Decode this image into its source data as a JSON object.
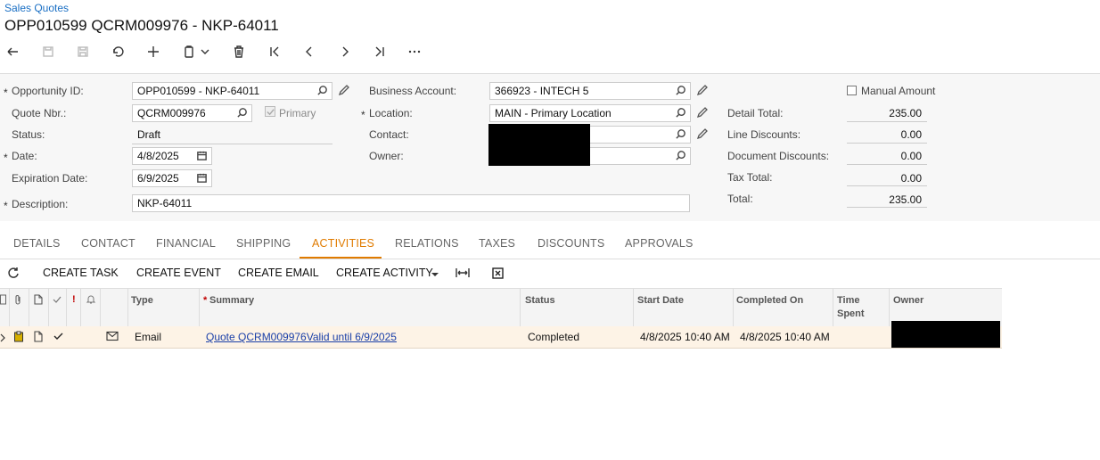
{
  "breadcrumb": "Sales Quotes",
  "title": "OPP010599 QCRM009976 - NKP-64011",
  "form": {
    "opportunity_id": {
      "label": "Opportunity ID:",
      "value": "OPP010599 - NKP-64011"
    },
    "quote_nbr": {
      "label": "Quote Nbr.:",
      "value": "QCRM009976"
    },
    "primary_label": "Primary",
    "status": {
      "label": "Status:",
      "value": "Draft"
    },
    "date": {
      "label": "Date:",
      "value": "4/8/2025"
    },
    "expiration_date": {
      "label": "Expiration Date:",
      "value": "6/9/2025"
    },
    "description": {
      "label": "Description:",
      "value": "NKP-64011"
    },
    "business_account": {
      "label": "Business Account:",
      "value": "366923 - INTECH 5"
    },
    "location": {
      "label": "Location:",
      "value": "MAIN - Primary Location"
    },
    "contact": {
      "label": "Contact:",
      "value": ""
    },
    "owner": {
      "label": "Owner:",
      "value": ""
    },
    "manual_amount_label": "Manual Amount",
    "detail_total": {
      "label": "Detail Total:",
      "value": "235.00"
    },
    "line_discounts": {
      "label": "Line Discounts:",
      "value": "0.00"
    },
    "document_discounts": {
      "label": "Document Discounts:",
      "value": "0.00"
    },
    "tax_total": {
      "label": "Tax Total:",
      "value": "0.00"
    },
    "total": {
      "label": "Total:",
      "value": "235.00"
    },
    "required_mark": "*"
  },
  "tabs": [
    "DETAILS",
    "CONTACT",
    "FINANCIAL",
    "SHIPPING",
    "ACTIVITIES",
    "RELATIONS",
    "TAXES",
    "DISCOUNTS",
    "APPROVALS"
  ],
  "active_tab": "ACTIVITIES",
  "grid_toolbar": {
    "create_task": "CREATE TASK",
    "create_event": "CREATE EVENT",
    "create_email": "CREATE EMAIL",
    "create_activity": "CREATE ACTIVITY"
  },
  "grid": {
    "headers": {
      "type": "Type",
      "summary": "Summary",
      "status": "Status",
      "start_date": "Start Date",
      "completed_on": "Completed On",
      "time_spent_1": "Time",
      "time_spent_2": "Spent",
      "owner": "Owner",
      "priority": "!"
    },
    "rows": [
      {
        "type": "Email",
        "summary": "Quote QCRM009976Valid until 6/9/2025",
        "status": "Completed",
        "start_date": "4/8/2025 10:40 AM",
        "completed_on": "4/8/2025 10:40 AM"
      }
    ]
  },
  "colors": {
    "accent": "#e07b00",
    "link": "#1a3fa8",
    "breadcrumb": "#1a6fc4",
    "row_bg": "#fdf3e6"
  }
}
